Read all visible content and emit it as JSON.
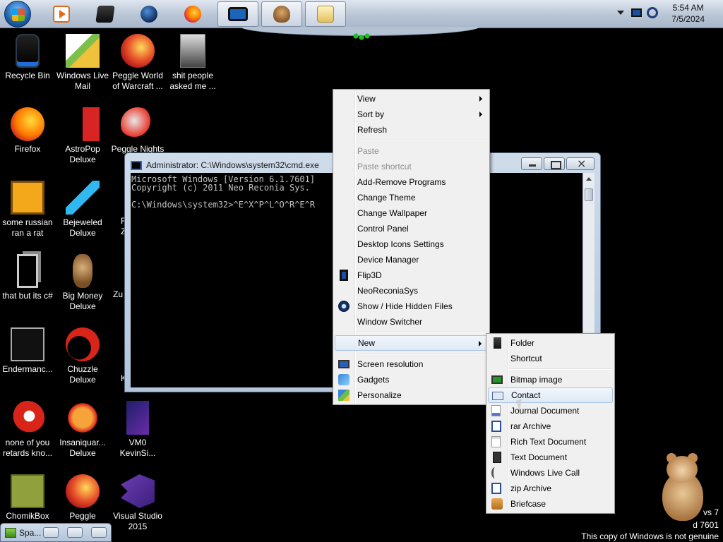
{
  "taskbar": {
    "clock_time": "5:54 AM",
    "clock_date": "7/5/2024",
    "pinned": [
      {
        "name": "media-player-icon"
      },
      {
        "name": "black-box-icon"
      },
      {
        "name": "globe-icon"
      },
      {
        "name": "firefox-icon"
      },
      {
        "name": "cmd-screen-icon"
      },
      {
        "name": "hamster-icon"
      },
      {
        "name": "folder-window-icon"
      }
    ]
  },
  "desktop": {
    "icons": [
      {
        "label": "Recycle Bin",
        "icon": "recycle-bin-icon"
      },
      {
        "label": "Windows Live Mail",
        "icon": "windows-live-mail-icon"
      },
      {
        "label": "Peggle World of Warcraft ...",
        "icon": "peggle-icon"
      },
      {
        "label": "shit people asked me ...",
        "icon": "file-icon"
      },
      {
        "label": "Firefox",
        "icon": "firefox-icon"
      },
      {
        "label": "AstroPop Deluxe",
        "icon": "astropop-icon"
      },
      {
        "label": "Peggle Nights",
        "icon": "peggle-nights-icon"
      },
      {
        "label": "some russian ran a rat",
        "icon": "shortcut-icon"
      },
      {
        "label": "Bejeweled Deluxe",
        "icon": "bejeweled-icon"
      },
      {
        "label": "that but its c#",
        "icon": "copy-icon"
      },
      {
        "label": "Big Money Deluxe",
        "icon": "big-money-icon"
      },
      {
        "label": "Endermanc...",
        "icon": "enderman-icon"
      },
      {
        "label": "Chuzzle Deluxe",
        "icon": "chuzzle-icon"
      },
      {
        "label": "none of you retards kno...",
        "icon": "red-ball-icon"
      },
      {
        "label": "Insaniquar... Deluxe",
        "icon": "insaniquarium-icon"
      },
      {
        "label": "VM0 KevinSi...",
        "icon": "vm-icon"
      },
      {
        "label": "ChomikBox",
        "icon": "chomikbox-icon"
      },
      {
        "label": "Peggle Deluxe",
        "icon": "peggle-deluxe-icon"
      },
      {
        "label": "Visual Studio 2015",
        "icon": "visual-studio-icon"
      }
    ],
    "partial_labels": [
      "F",
      "Z",
      "Zu",
      "K",
      "K"
    ]
  },
  "cmd": {
    "title": "Administrator: C:\\Windows\\system32\\cmd.exe",
    "lines": [
      "Microsoft Windows [Version 6.1.7601]",
      "Copyright (c) 2011 Neo Reconia Sys.",
      "",
      "C:\\Windows\\system32>^E^X^P^L^O^R^E^R"
    ]
  },
  "context_menu": {
    "items": [
      {
        "label": "View",
        "submenu": true
      },
      {
        "label": "Sort by",
        "submenu": true
      },
      {
        "label": "Refresh"
      },
      {
        "label": "Paste",
        "disabled": true
      },
      {
        "label": "Paste shortcut",
        "disabled": true
      },
      {
        "label": "Add-Remove Programs"
      },
      {
        "label": "Change Theme"
      },
      {
        "label": "Change Wallpaper"
      },
      {
        "label": "Control Panel"
      },
      {
        "label": "Desktop Icons Settings"
      },
      {
        "label": "Device Manager"
      },
      {
        "label": "Flip3D"
      },
      {
        "label": "NeoReconiaSys"
      },
      {
        "label": "Show / Hide Hidden Files"
      },
      {
        "label": "Window Switcher"
      },
      {
        "label": "New",
        "submenu": true
      },
      {
        "label": "Screen resolution"
      },
      {
        "label": "Gadgets"
      },
      {
        "label": "Personalize"
      }
    ]
  },
  "new_submenu": {
    "items": [
      {
        "label": "Folder"
      },
      {
        "label": "Shortcut"
      },
      {
        "label": "Bitmap image"
      },
      {
        "label": "Contact"
      },
      {
        "label": "Journal Document"
      },
      {
        "label": "rar Archive"
      },
      {
        "label": "Rich Text Document"
      },
      {
        "label": "Text Document"
      },
      {
        "label": "Windows Live Call"
      },
      {
        "label": "zip Archive"
      },
      {
        "label": "Briefcase"
      }
    ]
  },
  "mini_window": {
    "title": "Spa..."
  },
  "watermark": {
    "line1": "vs 7",
    "line2": "d 7601",
    "line3": "This copy of Windows is not genuine"
  }
}
